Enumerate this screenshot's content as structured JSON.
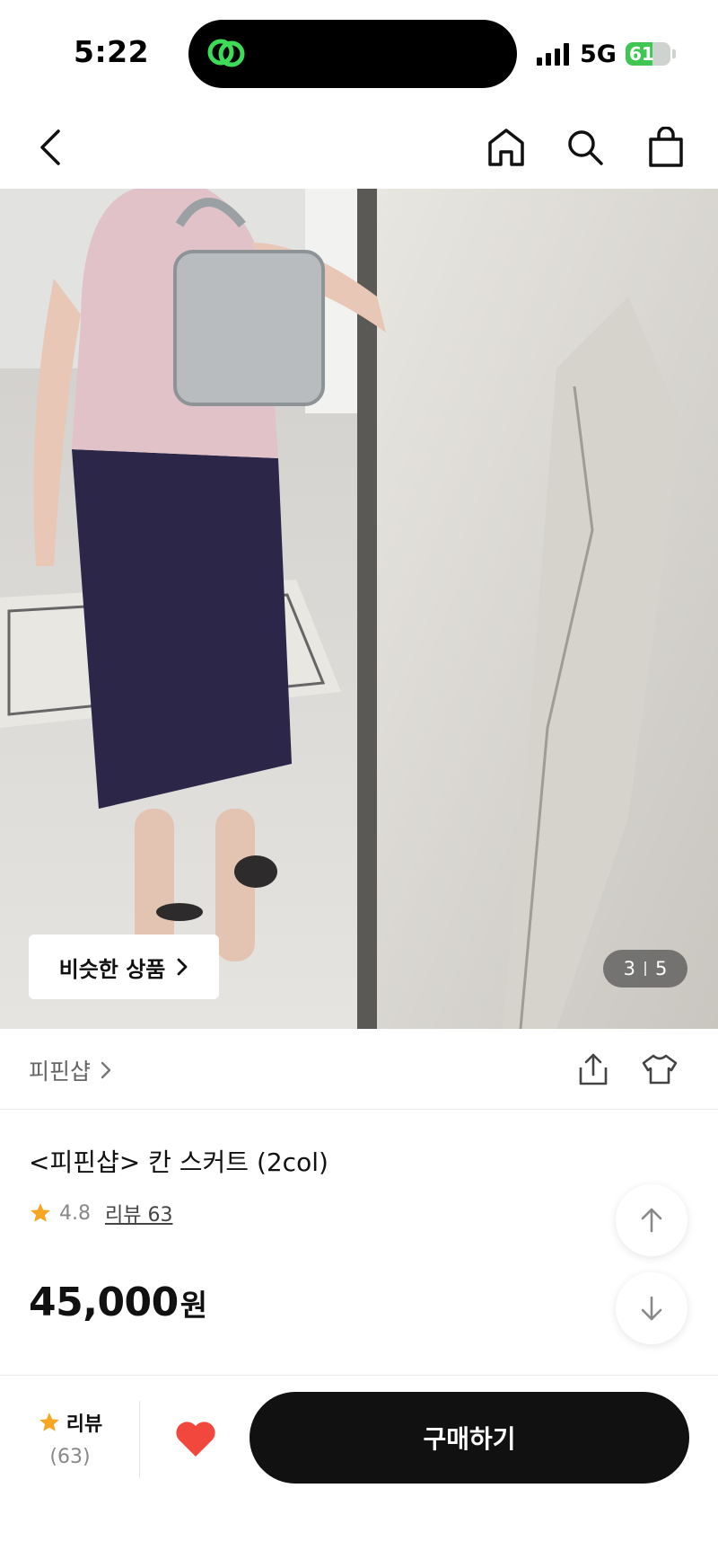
{
  "status_bar": {
    "time": "5:22",
    "network": "5G",
    "battery_level": 61,
    "battery_label": "61"
  },
  "nav": {
    "icons": [
      "back-icon",
      "home-icon",
      "search-icon",
      "shopping-bag-icon"
    ]
  },
  "gallery": {
    "similar_label": "비슷한 상품",
    "current_page": "3",
    "total_pages": "5"
  },
  "store": {
    "name": "피핀샵"
  },
  "product": {
    "title": "<피핀샵> 칸 스커트 (2col)",
    "rating": "4.8",
    "review_link": "리뷰 63",
    "price": "45,000",
    "price_unit": "원"
  },
  "bottom_bar": {
    "review_label": "리뷰",
    "review_count": "(63)",
    "buy_label": "구매하기"
  },
  "colors": {
    "star": "#f5a623",
    "heart": "#f2473d",
    "buy_button": "#111111",
    "battery": "#3fc653"
  }
}
